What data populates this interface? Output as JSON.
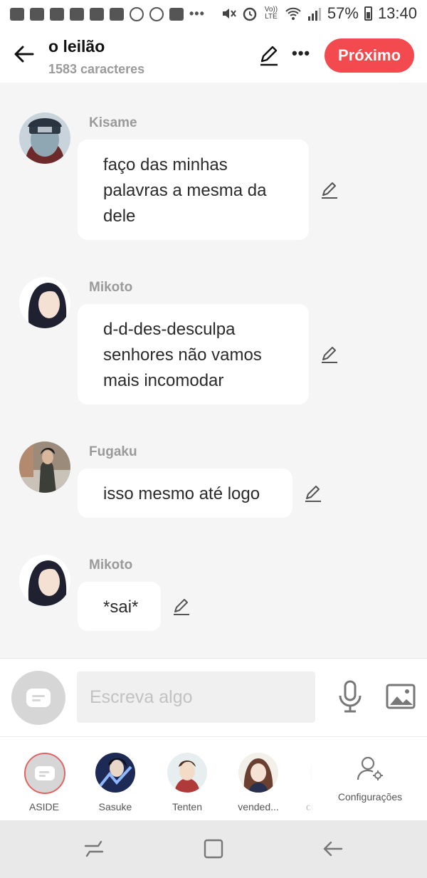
{
  "status_bar": {
    "battery_percent": "57%",
    "time": "13:40",
    "network_label": "Vo)) LTE"
  },
  "header": {
    "title": "o leilão",
    "subtitle": "1583 caracteres",
    "next_label": "Próximo"
  },
  "messages": [
    {
      "author": "Kisame",
      "lines": [
        "faço das minhas",
        "palavras a mesma da",
        "dele"
      ]
    },
    {
      "author": "Mikoto",
      "lines": [
        "d-d-des-desculpa",
        "senhores não vamos",
        "mais incomodar"
      ]
    },
    {
      "author": "Fugaku",
      "lines": [
        "isso mesmo até logo"
      ]
    },
    {
      "author": "Mikoto",
      "lines": [
        "*sai*"
      ]
    }
  ],
  "composer": {
    "placeholder": "Escreva algo"
  },
  "roles": [
    {
      "label": "ASIDE",
      "selected": true
    },
    {
      "label": "Sasuke"
    },
    {
      "label": "Tenten"
    },
    {
      "label": "vended..."
    },
    {
      "label": "co"
    }
  ],
  "settings_label": "Configurações",
  "colors": {
    "accent": "#f24a4e",
    "background": "#f5f5f5",
    "bubble": "#ffffff",
    "name_gray": "#9a9a9a"
  }
}
